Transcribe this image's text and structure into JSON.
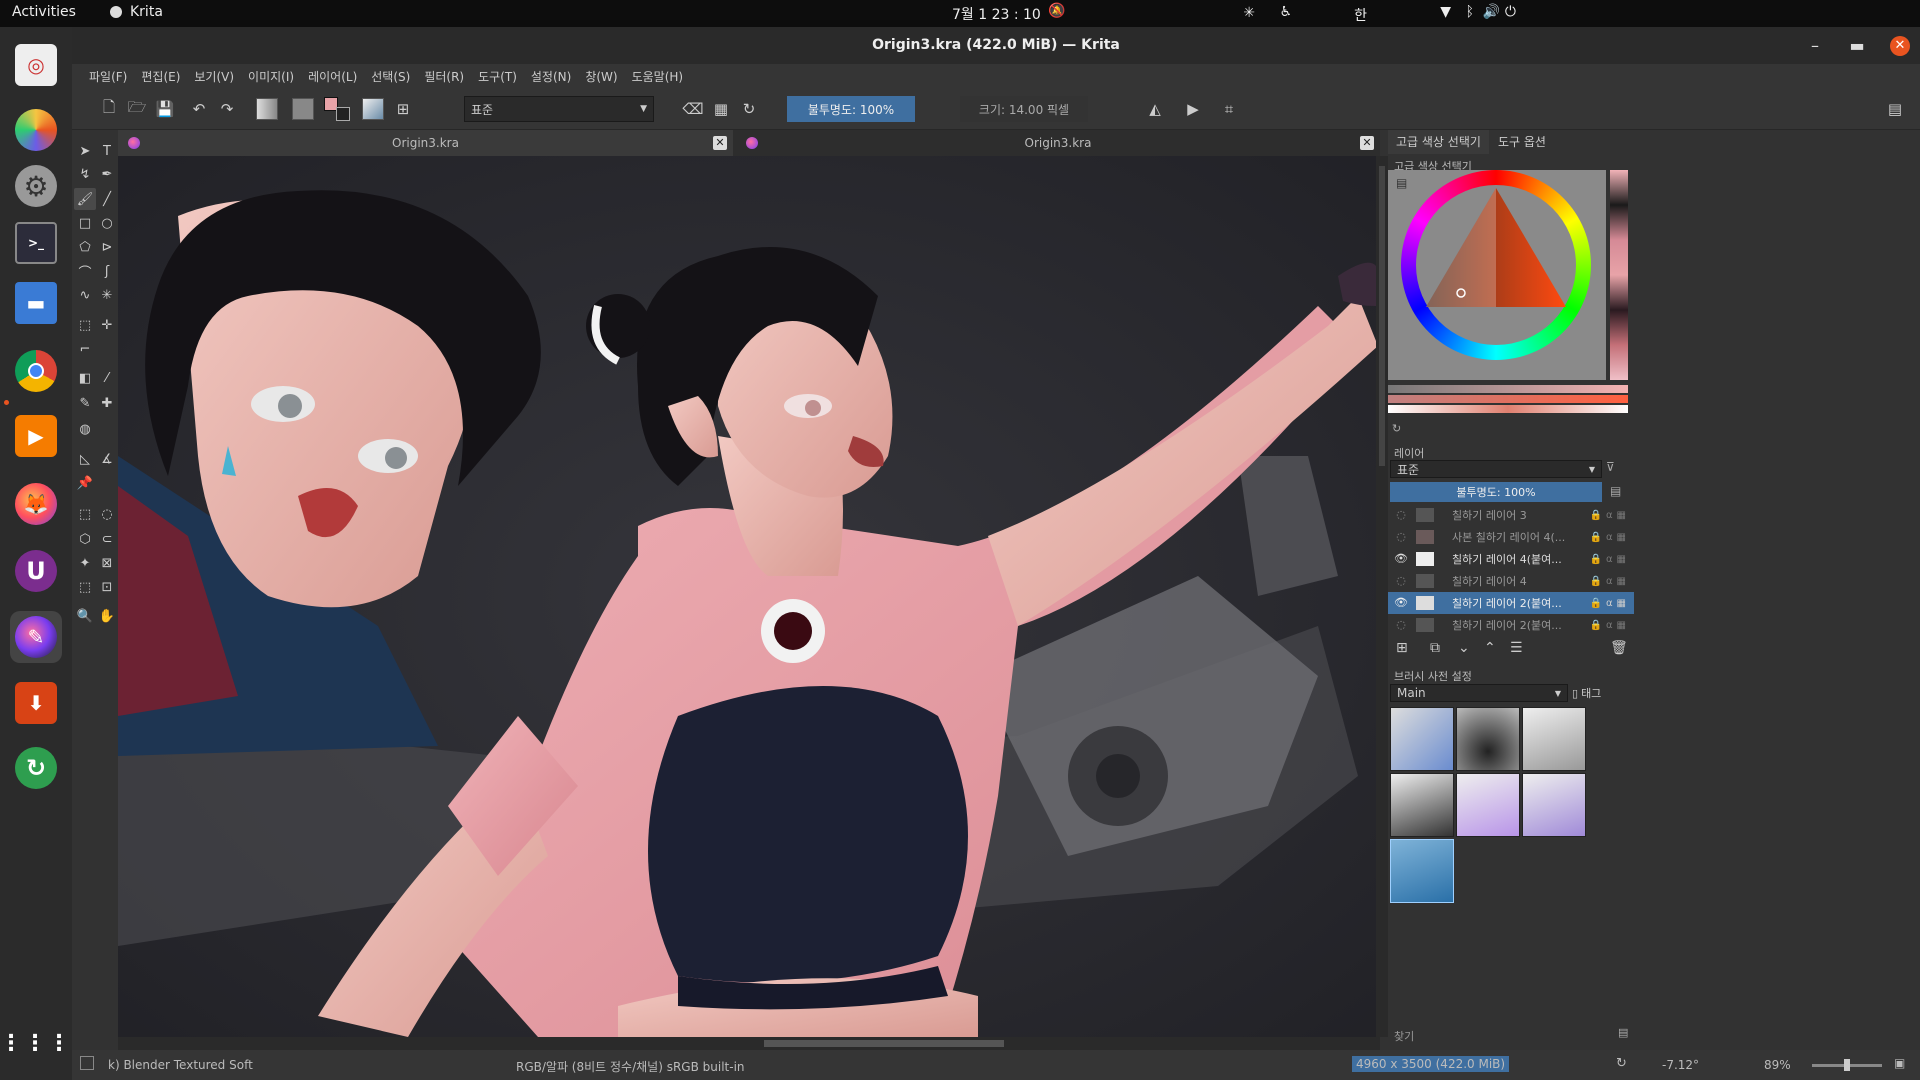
{
  "topbar": {
    "activities": "Activities",
    "app_name": "Krita",
    "clock": "7월 1  23 : 10",
    "input_method": "한"
  },
  "window": {
    "title": "Origin3.kra (422.0 MiB) — Krita"
  },
  "menu": [
    "파일(F)",
    "편집(E)",
    "보기(V)",
    "이미지(I)",
    "레이어(L)",
    "선택(S)",
    "필터(R)",
    "도구(T)",
    "설정(N)",
    "창(W)",
    "도움말(H)"
  ],
  "toolbar": {
    "blend_mode": "표준",
    "opacity": "불투명도: 100%",
    "size": "크기: 14.00 픽셀"
  },
  "tabs": [
    {
      "title": "Origin3.kra"
    },
    {
      "title": "Origin3.kra"
    }
  ],
  "dockers": {
    "tabs": [
      "고급 색상 선택기",
      "도구 옵션"
    ],
    "color_selector_title": "고급 색상 선택기",
    "layers_title": "레이어",
    "layers_blend": "표준",
    "layers_opacity": "불투명도: 100%",
    "layers": [
      {
        "name": "칠하기 레이어 3",
        "visible": false,
        "selected": false
      },
      {
        "name": "사본 칠하기 레이어 4(...",
        "visible": false,
        "selected": false
      },
      {
        "name": "칠하기 레이어 4(붙여...",
        "visible": true,
        "selected": false
      },
      {
        "name": "칠하기 레이어 4",
        "visible": false,
        "selected": false
      },
      {
        "name": "칠하기 레이어 2(붙여...",
        "visible": true,
        "selected": true
      },
      {
        "name": "칠하기 레이어 2(붙여...",
        "visible": false,
        "selected": false
      }
    ],
    "brush_presets_title": "브러시 사전 설정",
    "brush_tag": "Main",
    "tag_label": "태그",
    "search_label": "찾기"
  },
  "status": {
    "brush": "k) Blender Textured Soft",
    "color_space": "RGB/알파 (8비트 정수/채널)  sRGB built-in",
    "dimensions": "4960 x 3500 (422.0 MiB)",
    "rotation": "-7.12°",
    "zoom": "89%"
  },
  "colors": {
    "accent": "#3f6fa0",
    "ubuntu_orange": "#e95420",
    "shirt_pink": "#e8a3a8",
    "top_navy": "#1c2033"
  }
}
